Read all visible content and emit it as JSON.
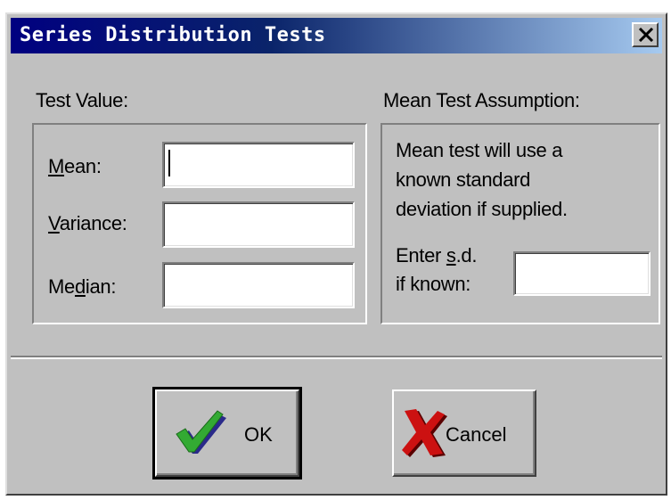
{
  "window": {
    "title": "Series Distribution Tests"
  },
  "test_value": {
    "group_label": "Test Value:",
    "mean": {
      "label": "Mean:",
      "mnemonic": "M",
      "value": ""
    },
    "variance": {
      "label": "Variance:",
      "mnemonic": "V",
      "value": ""
    },
    "median": {
      "label": "Median:",
      "mnemonic": "d",
      "value": ""
    }
  },
  "mean_test": {
    "group_label": "Mean Test Assumption:",
    "description_lines": [
      "Mean test will use a",
      "known standard",
      "deviation if supplied."
    ],
    "sd_label_line1": "Enter s.d.",
    "sd_label_line2": "if known:",
    "sd_value": ""
  },
  "buttons": {
    "ok_label": "OK",
    "cancel_label": "Cancel"
  },
  "icons": {
    "ok": "green-checkmark-icon",
    "cancel": "red-x-icon",
    "close": "close-icon"
  },
  "colors": {
    "title_bar": "#000080",
    "face": "#c0c0c0",
    "check_green": "#33aa33",
    "cross_red": "#cc1111"
  }
}
